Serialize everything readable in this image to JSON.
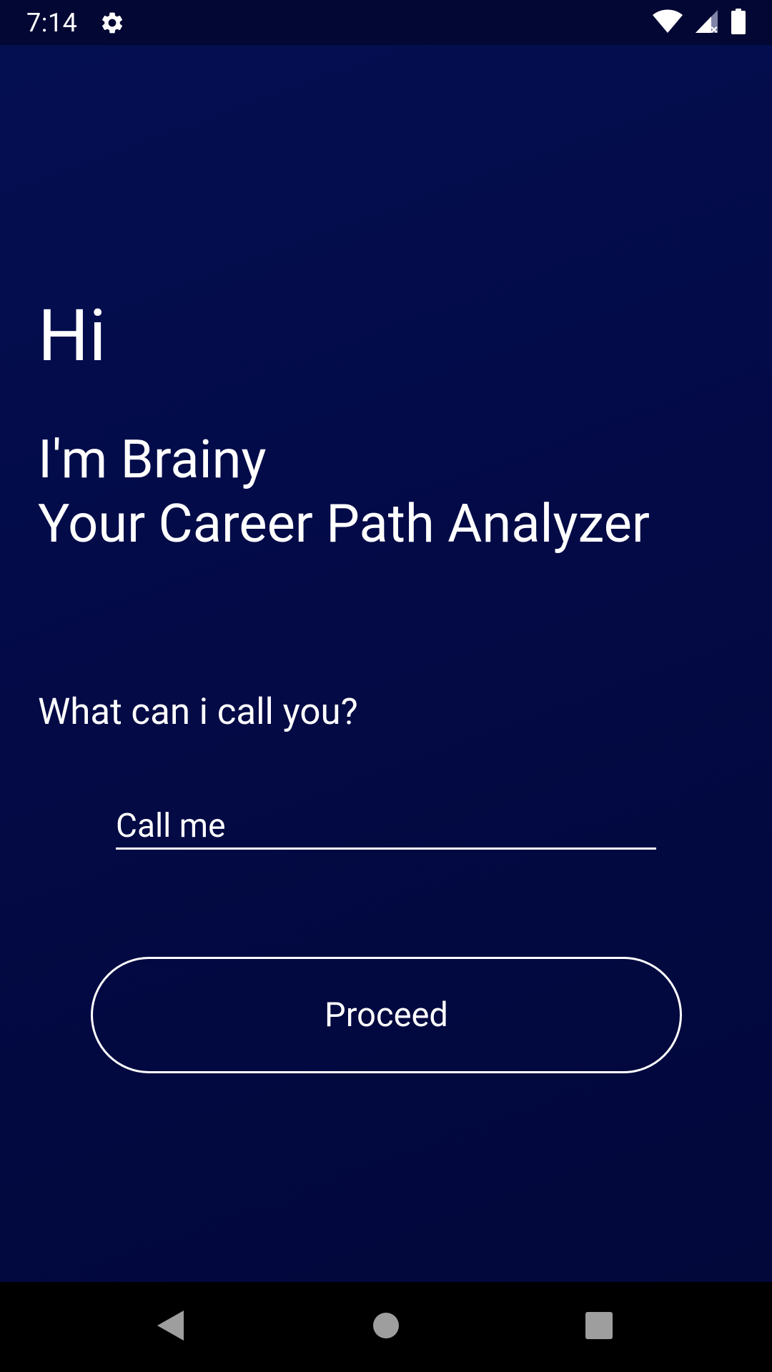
{
  "status_bar": {
    "time": "7:14",
    "icons": [
      "settings-gear-icon",
      "wifi-icon",
      "signal-icon",
      "battery-icon"
    ]
  },
  "greeting": {
    "hi": "Hi",
    "line1": "I'm Brainy",
    "line2": "Your Career Path Analyzer"
  },
  "question": "What can i call you?",
  "name_input": {
    "placeholder": "Call me",
    "value": ""
  },
  "proceed_button": {
    "label": "Proceed"
  },
  "nav_bar": {
    "icons": [
      "back-icon",
      "home-icon",
      "recents-icon"
    ]
  },
  "colors": {
    "background": "#030947",
    "status_bar": "#020833",
    "text": "#ffffff",
    "nav_bar": "#000000",
    "nav_icon": "#9e9e9e"
  }
}
